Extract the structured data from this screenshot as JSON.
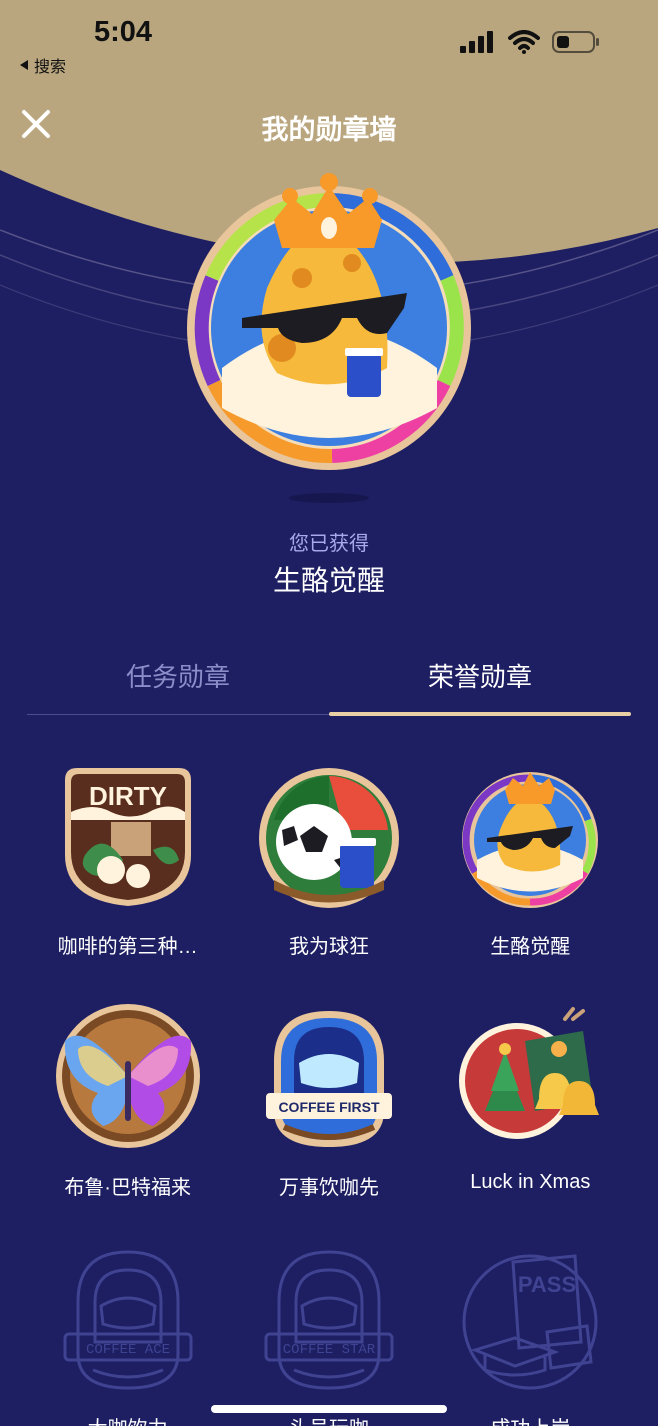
{
  "status": {
    "time": "5:04",
    "back_label": "搜索"
  },
  "header": {
    "title": "我的勋章墙",
    "close_icon": "close-icon"
  },
  "hero": {
    "earned_label": "您已获得",
    "badge_name": "生酪觉醒"
  },
  "tabs": [
    {
      "label": "任务勋章",
      "active": false
    },
    {
      "label": "荣誉勋章",
      "active": true
    }
  ],
  "badges": [
    {
      "name": "咖啡的第三种…",
      "icon": "dirty-coffee-badge",
      "unlocked": true
    },
    {
      "name": "我为球狂",
      "icon": "soccer-badge",
      "unlocked": true
    },
    {
      "name": "生酪觉醒",
      "icon": "cheese-sunglasses-badge",
      "unlocked": true
    },
    {
      "name": "布鲁·巴特福来",
      "icon": "butterfly-badge",
      "unlocked": true
    },
    {
      "name": "万事饮咖先",
      "icon": "coffee-first-badge",
      "unlocked": true
    },
    {
      "name": "Luck in Xmas",
      "icon": "xmas-bells-badge",
      "unlocked": true
    },
    {
      "name": "大咖饮力",
      "icon": "coffee-ace-badge",
      "unlocked": false
    },
    {
      "name": "头号玩咖",
      "icon": "coffee-star-badge",
      "unlocked": false
    },
    {
      "name": "成功上岸",
      "icon": "pass-badge",
      "unlocked": false
    }
  ],
  "badge_texts": {
    "dirty": "DIRTY",
    "coffee_first": "COFFEE FIRST",
    "coffee_ace": "COFFEE ACE",
    "coffee_star": "COFFEE STAR",
    "pass": "PASS"
  },
  "colors": {
    "background": "#1e1f63",
    "header_gold": "#b9a67e",
    "tab_underline": "#e9cfa5",
    "locked_outline": "#3f4391"
  }
}
